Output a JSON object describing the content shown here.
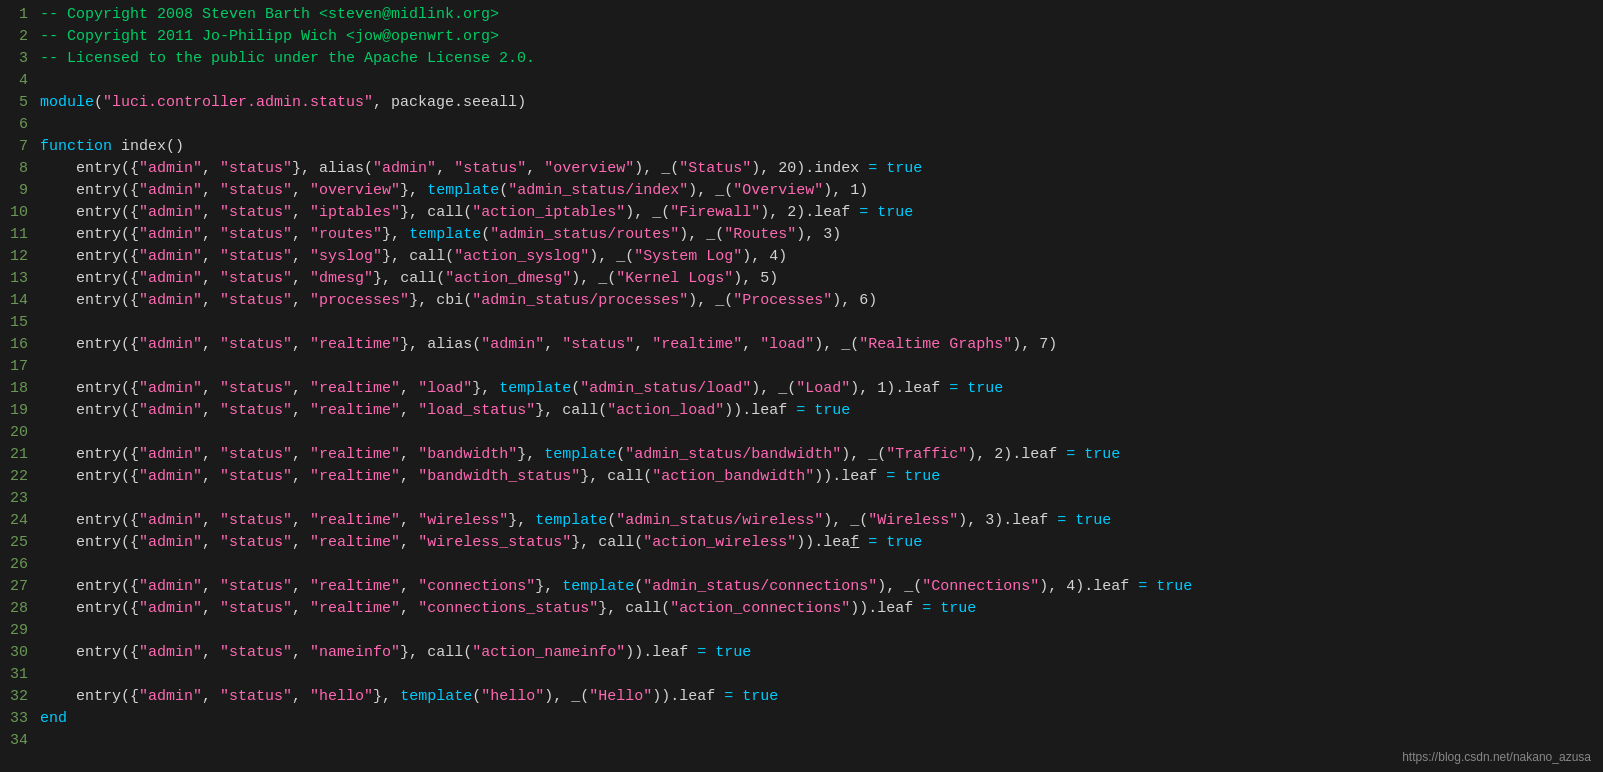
{
  "watermark": "https://blog.csdn.net/nakano_azusa",
  "lines": [
    {
      "num": "1",
      "content": "comment",
      "html": "<span class=\"comment\">-- Copyright 2008 Steven Barth &lt;steven@midlink.org&gt;</span>"
    },
    {
      "num": "2",
      "content": "comment",
      "html": "<span class=\"comment\">-- Copyright 2011 Jo-Philipp Wich &lt;jow@openwrt.org&gt;</span>"
    },
    {
      "num": "3",
      "content": "comment",
      "html": "<span class=\"comment\">-- Licensed to the public under the Apache License 2.0.</span>"
    },
    {
      "num": "4",
      "content": "empty",
      "html": ""
    },
    {
      "num": "5",
      "content": "module",
      "html": "<span class=\"func\">module</span><span class=\"paren\">(</span><span class=\"string-pink\">\"luci.controller.admin.status\"</span><span class=\"plain\">, </span><span class=\"plain\">package.seeall</span><span class=\"paren\">)</span>"
    },
    {
      "num": "6",
      "content": "empty",
      "html": ""
    },
    {
      "num": "7",
      "content": "func",
      "html": "<span class=\"keyword\">function</span><span class=\"plain\"> index()</span>"
    },
    {
      "num": "8",
      "content": "entry",
      "html": "    <span class=\"plain\">entry({</span><span class=\"string-pink\">\"admin\"</span><span class=\"plain\">, </span><span class=\"string-pink\">\"status\"</span><span class=\"plain\">}, </span><span class=\"plain\">alias(</span><span class=\"string-pink\">\"admin\"</span><span class=\"plain\">, </span><span class=\"string-pink\">\"status\"</span><span class=\"plain\">, </span><span class=\"string-pink\">\"overview\"</span><span class=\"plain\">), _(</span><span class=\"string-pink\">\"Status\"</span><span class=\"plain\">), 20).index </span><span class=\"equals\">=</span><span class=\"plain\"> </span><span class=\"true-kw\">true</span>"
    },
    {
      "num": "9",
      "content": "entry",
      "html": "    <span class=\"plain\">entry({</span><span class=\"string-pink\">\"admin\"</span><span class=\"plain\">, </span><span class=\"string-pink\">\"status\"</span><span class=\"plain\">, </span><span class=\"string-pink\">\"overview\"</span><span class=\"plain\">}, </span><span class=\"func\">template</span><span class=\"plain\">(</span><span class=\"string-pink\">\"admin_status/index\"</span><span class=\"plain\">), _(</span><span class=\"string-pink\">\"Overview\"</span><span class=\"plain\">), 1)</span>"
    },
    {
      "num": "10",
      "content": "entry",
      "html": "    <span class=\"plain\">entry({</span><span class=\"string-pink\">\"admin\"</span><span class=\"plain\">, </span><span class=\"string-pink\">\"status\"</span><span class=\"plain\">, </span><span class=\"string-pink\">\"iptables\"</span><span class=\"plain\">}, </span><span class=\"plain\">call(</span><span class=\"string-pink\">\"action_iptables\"</span><span class=\"plain\">), _(</span><span class=\"string-pink\">\"Firewall\"</span><span class=\"plain\">), 2).leaf </span><span class=\"equals\">=</span><span class=\"plain\"> </span><span class=\"true-kw\">true</span>"
    },
    {
      "num": "11",
      "content": "entry",
      "html": "    <span class=\"plain\">entry({</span><span class=\"string-pink\">\"admin\"</span><span class=\"plain\">, </span><span class=\"string-pink\">\"status\"</span><span class=\"plain\">, </span><span class=\"string-pink\">\"routes\"</span><span class=\"plain\">}, </span><span class=\"func\">template</span><span class=\"plain\">(</span><span class=\"string-pink\">\"admin_status/routes\"</span><span class=\"plain\">), _(</span><span class=\"string-pink\">\"Routes\"</span><span class=\"plain\">), 3)</span>"
    },
    {
      "num": "12",
      "content": "entry",
      "html": "    <span class=\"plain\">entry({</span><span class=\"string-pink\">\"admin\"</span><span class=\"plain\">, </span><span class=\"string-pink\">\"status\"</span><span class=\"plain\">, </span><span class=\"string-pink\">\"syslog\"</span><span class=\"plain\">}, </span><span class=\"plain\">call(</span><span class=\"string-pink\">\"action_syslog\"</span><span class=\"plain\">), _(</span><span class=\"string-pink\">\"System Log\"</span><span class=\"plain\">), 4)</span>"
    },
    {
      "num": "13",
      "content": "entry",
      "html": "    <span class=\"plain\">entry({</span><span class=\"string-pink\">\"admin\"</span><span class=\"plain\">, </span><span class=\"string-pink\">\"status\"</span><span class=\"plain\">, </span><span class=\"string-pink\">\"dmesg\"</span><span class=\"plain\">}, </span><span class=\"plain\">call(</span><span class=\"string-pink\">\"action_dmesg\"</span><span class=\"plain\">), _(</span><span class=\"string-pink\">\"Kernel Logs\"</span><span class=\"plain\">), 5)</span>"
    },
    {
      "num": "14",
      "content": "entry",
      "html": "    <span class=\"plain\">entry({</span><span class=\"string-pink\">\"admin\"</span><span class=\"plain\">, </span><span class=\"string-pink\">\"status\"</span><span class=\"plain\">, </span><span class=\"string-pink\">\"processes\"</span><span class=\"plain\">}, </span><span class=\"plain\">cbi(</span><span class=\"string-pink\">\"admin_status/processes\"</span><span class=\"plain\">), _(</span><span class=\"string-pink\">\"Processes\"</span><span class=\"plain\">), 6)</span>"
    },
    {
      "num": "15",
      "content": "empty",
      "html": ""
    },
    {
      "num": "16",
      "content": "entry",
      "html": "    <span class=\"plain\">entry({</span><span class=\"string-pink\">\"admin\"</span><span class=\"plain\">, </span><span class=\"string-pink\">\"status\"</span><span class=\"plain\">, </span><span class=\"string-pink\">\"realtime\"</span><span class=\"plain\">}, </span><span class=\"plain\">alias(</span><span class=\"string-pink\">\"admin\"</span><span class=\"plain\">, </span><span class=\"string-pink\">\"status\"</span><span class=\"plain\">, </span><span class=\"string-pink\">\"realtime\"</span><span class=\"plain\">, </span><span class=\"string-pink\">\"load\"</span><span class=\"plain\">), _(</span><span class=\"string-pink\">\"Realtime Graphs\"</span><span class=\"plain\">), 7)</span>"
    },
    {
      "num": "17",
      "content": "empty",
      "html": ""
    },
    {
      "num": "18",
      "content": "entry",
      "html": "    <span class=\"plain\">entry({</span><span class=\"string-pink\">\"admin\"</span><span class=\"plain\">, </span><span class=\"string-pink\">\"status\"</span><span class=\"plain\">, </span><span class=\"string-pink\">\"realtime\"</span><span class=\"plain\">, </span><span class=\"string-pink\">\"load\"</span><span class=\"plain\">}, </span><span class=\"func\">template</span><span class=\"plain\">(</span><span class=\"string-pink\">\"admin_status/load\"</span><span class=\"plain\">), _(</span><span class=\"string-pink\">\"Load\"</span><span class=\"plain\">), 1).leaf </span><span class=\"equals\">=</span><span class=\"plain\"> </span><span class=\"true-kw\">true</span>"
    },
    {
      "num": "19",
      "content": "entry",
      "html": "    <span class=\"plain\">entry({</span><span class=\"string-pink\">\"admin\"</span><span class=\"plain\">, </span><span class=\"string-pink\">\"status\"</span><span class=\"plain\">, </span><span class=\"string-pink\">\"realtime\"</span><span class=\"plain\">, </span><span class=\"string-pink\">\"load_status\"</span><span class=\"plain\">}, </span><span class=\"plain\">call(</span><span class=\"string-pink\">\"action_load\"</span><span class=\"plain\">)).leaf </span><span class=\"equals\">=</span><span class=\"plain\"> </span><span class=\"true-kw\">true</span>"
    },
    {
      "num": "20",
      "content": "empty",
      "html": ""
    },
    {
      "num": "21",
      "content": "entry",
      "html": "    <span class=\"plain\">entry({</span><span class=\"string-pink\">\"admin\"</span><span class=\"plain\">, </span><span class=\"string-pink\">\"status\"</span><span class=\"plain\">, </span><span class=\"string-pink\">\"realtime\"</span><span class=\"plain\">, </span><span class=\"string-pink\">\"bandwidth\"</span><span class=\"plain\">}, </span><span class=\"func\">template</span><span class=\"plain\">(</span><span class=\"string-pink\">\"admin_status/bandwidth\"</span><span class=\"plain\">), _(</span><span class=\"string-pink\">\"Traffic\"</span><span class=\"plain\">), 2).leaf </span><span class=\"equals\">=</span><span class=\"plain\"> </span><span class=\"true-kw\">true</span>"
    },
    {
      "num": "22",
      "content": "entry",
      "html": "    <span class=\"plain\">entry({</span><span class=\"string-pink\">\"admin\"</span><span class=\"plain\">, </span><span class=\"string-pink\">\"status\"</span><span class=\"plain\">, </span><span class=\"string-pink\">\"realtime\"</span><span class=\"plain\">, </span><span class=\"string-pink\">\"bandwidth_status\"</span><span class=\"plain\">}, </span><span class=\"plain\">call(</span><span class=\"string-pink\">\"action_bandwidth\"</span><span class=\"plain\">)).leaf </span><span class=\"equals\">=</span><span class=\"plain\"> </span><span class=\"true-kw\">true</span>"
    },
    {
      "num": "23",
      "content": "empty",
      "html": ""
    },
    {
      "num": "24",
      "content": "entry",
      "html": "    <span class=\"plain\">entry({</span><span class=\"string-pink\">\"admin\"</span><span class=\"plain\">, </span><span class=\"string-pink\">\"status\"</span><span class=\"plain\">, </span><span class=\"string-pink\">\"realtime\"</span><span class=\"plain\">, </span><span class=\"string-pink\">\"wireless\"</span><span class=\"plain\">}, </span><span class=\"func\">template</span><span class=\"plain\">(</span><span class=\"string-pink\">\"admin_status/wireless\"</span><span class=\"plain\">), _(</span><span class=\"string-pink\">\"Wireless\"</span><span class=\"plain\">), 3).leaf </span><span class=\"equals\">=</span><span class=\"plain\"> </span><span class=\"true-kw\">true</span>"
    },
    {
      "num": "25",
      "content": "entry",
      "html": "    <span class=\"plain\">entry({</span><span class=\"string-pink\">\"admin\"</span><span class=\"plain\">, </span><span class=\"string-pink\">\"status\"</span><span class=\"plain\">, </span><span class=\"string-pink\">\"realtime\"</span><span class=\"plain\">, </span><span class=\"string-pink\">\"wireless_status\"</span><span class=\"plain\">}, </span><span class=\"plain\">call(</span><span class=\"string-pink\">\"action_wireless\"</span><span class=\"plain\">)).lea<span style=\"text-decoration:underline;\">f</span> </span><span class=\"equals\">=</span><span class=\"plain\"> </span><span class=\"true-kw\">true</span>"
    },
    {
      "num": "26",
      "content": "empty",
      "html": ""
    },
    {
      "num": "27",
      "content": "entry",
      "html": "    <span class=\"plain\">entry({</span><span class=\"string-pink\">\"admin\"</span><span class=\"plain\">, </span><span class=\"string-pink\">\"status\"</span><span class=\"plain\">, </span><span class=\"string-pink\">\"realtime\"</span><span class=\"plain\">, </span><span class=\"string-pink\">\"connections\"</span><span class=\"plain\">}, </span><span class=\"func\">template</span><span class=\"plain\">(</span><span class=\"string-pink\">\"admin_status/connections\"</span><span class=\"plain\">), _(</span><span class=\"string-pink\">\"Connections\"</span><span class=\"plain\">), 4).leaf </span><span class=\"equals\">=</span><span class=\"plain\"> </span><span class=\"true-kw\">true</span>"
    },
    {
      "num": "28",
      "content": "entry",
      "html": "    <span class=\"plain\">entry({</span><span class=\"string-pink\">\"admin\"</span><span class=\"plain\">, </span><span class=\"string-pink\">\"status\"</span><span class=\"plain\">, </span><span class=\"string-pink\">\"realtime\"</span><span class=\"plain\">, </span><span class=\"string-pink\">\"connections_status\"</span><span class=\"plain\">}, </span><span class=\"plain\">call(</span><span class=\"string-pink\">\"action_connections\"</span><span class=\"plain\">)).leaf </span><span class=\"equals\">=</span><span class=\"plain\"> </span><span class=\"true-kw\">true</span>"
    },
    {
      "num": "29",
      "content": "empty",
      "html": ""
    },
    {
      "num": "30",
      "content": "entry",
      "html": "    <span class=\"plain\">entry({</span><span class=\"string-pink\">\"admin\"</span><span class=\"plain\">, </span><span class=\"string-pink\">\"status\"</span><span class=\"plain\">, </span><span class=\"string-pink\">\"nameinfo\"</span><span class=\"plain\">}, </span><span class=\"plain\">call(</span><span class=\"string-pink\">\"action_nameinfo\"</span><span class=\"plain\">)).leaf </span><span class=\"equals\">=</span><span class=\"plain\"> </span><span class=\"true-kw\">true</span>"
    },
    {
      "num": "31",
      "content": "empty",
      "html": ""
    },
    {
      "num": "32",
      "content": "entry",
      "html": "    <span class=\"plain\">entry({</span><span class=\"string-pink\">\"admin\"</span><span class=\"plain\">, </span><span class=\"string-pink\">\"status\"</span><span class=\"plain\">, </span><span class=\"string-pink\">\"hello\"</span><span class=\"plain\">}, </span><span class=\"func\">template</span><span class=\"plain\">(</span><span class=\"string-pink\">\"hello\"</span><span class=\"plain\">), _(</span><span class=\"string-pink\">\"Hello\"</span><span class=\"plain\">)).leaf </span><span class=\"equals\">=</span><span class=\"plain\"> </span><span class=\"true-kw\">true</span>"
    },
    {
      "num": "33",
      "content": "end",
      "html": "<span class=\"keyword\">end</span>"
    },
    {
      "num": "34",
      "content": "empty",
      "html": ""
    }
  ]
}
